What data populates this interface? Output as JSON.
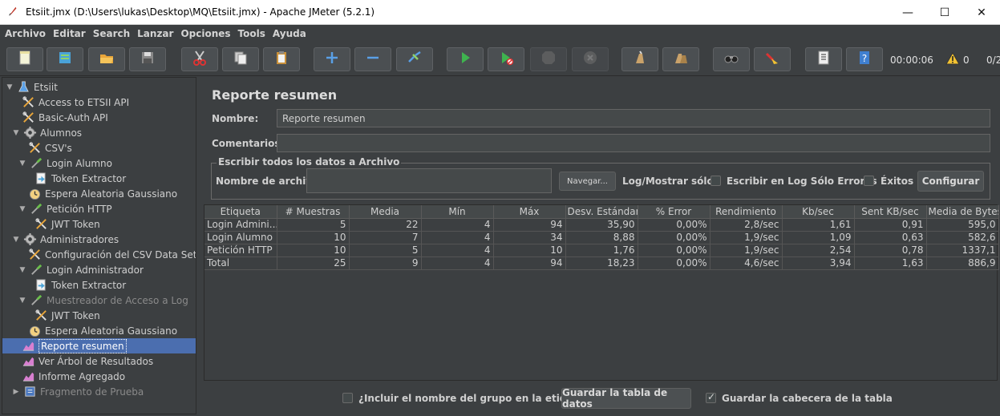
{
  "window": {
    "title": "Etsiit.jmx (D:\\Users\\lukas\\Desktop\\MQ\\Etsiit.jmx) - Apache JMeter (5.2.1)",
    "controls": [
      "—",
      "☐",
      "✕"
    ]
  },
  "menu": [
    "Archivo",
    "Editar",
    "Search",
    "Lanzar",
    "Opciones",
    "Tools",
    "Ayuda"
  ],
  "toolbar": {
    "buttons": [
      "new-icon",
      "templates-icon",
      "open-icon",
      "save-icon",
      "cut-icon",
      "copy-icon",
      "paste-icon",
      "expand-icon",
      "collapse-icon",
      "toggle-icon",
      "start-icon",
      "start-no-pause-icon",
      "stop-icon",
      "shutdown-icon",
      "clear-icon",
      "clear-all-icon",
      "search-icon",
      "reset-search-icon",
      "function-helper-icon",
      "help-icon"
    ],
    "elapsed": "00:00:06",
    "warnings": "0",
    "threads": "0/2"
  },
  "tree": [
    {
      "label": "Etsiit",
      "icon": "test-plan-icon",
      "level": 0,
      "expanded": true
    },
    {
      "label": "Access to ETSII API",
      "icon": "config-icon",
      "level": 1
    },
    {
      "label": "Basic-Auth API",
      "icon": "config-icon",
      "level": 1
    },
    {
      "label": "Alumnos",
      "icon": "thread-group-icon",
      "level": 1,
      "expanded": true
    },
    {
      "label": "CSV's",
      "icon": "config-icon",
      "level": 2
    },
    {
      "label": "Login Alumno",
      "icon": "sampler-icon",
      "level": 2,
      "expanded": true
    },
    {
      "label": "Token Extractor",
      "icon": "extractor-icon",
      "level": 3
    },
    {
      "label": "Espera Aleatoria Gaussiano",
      "icon": "timer-icon",
      "level": 2
    },
    {
      "label": "Petición HTTP",
      "icon": "sampler-icon",
      "level": 2,
      "expanded": true
    },
    {
      "label": "JWT Token",
      "icon": "config-icon",
      "level": 3
    },
    {
      "label": "Administradores",
      "icon": "thread-group-icon",
      "level": 1,
      "expanded": true
    },
    {
      "label": "Configuración del CSV Data Set",
      "icon": "config-icon",
      "level": 2
    },
    {
      "label": "Login Administrador",
      "icon": "sampler-icon",
      "level": 2,
      "expanded": true
    },
    {
      "label": "Token Extractor",
      "icon": "extractor-icon",
      "level": 3
    },
    {
      "label": "Muestreador de Acceso a Log",
      "icon": "sampler-icon",
      "level": 2,
      "expanded": true,
      "disabled": true
    },
    {
      "label": "JWT Token",
      "icon": "config-icon",
      "level": 3
    },
    {
      "label": "Espera Aleatoria Gaussiano",
      "icon": "timer-icon",
      "level": 2
    },
    {
      "label": "Reporte resumen",
      "icon": "listener-icon",
      "level": 1,
      "selected": true
    },
    {
      "label": "Ver Árbol de Resultados",
      "icon": "listener-icon",
      "level": 1
    },
    {
      "label": "Informe Agregado",
      "icon": "listener-icon",
      "level": 1
    },
    {
      "label": "Fragmento de Prueba",
      "icon": "fragment-icon",
      "level": 1,
      "collapsed": true,
      "disabled": true
    }
  ],
  "panel": {
    "title": "Reporte resumen",
    "name_label": "Nombre:",
    "name_value": "Reporte resumen",
    "comments_label": "Comentarios",
    "comments_value": "",
    "file_group_legend": "Escribir todos los datos a Archivo",
    "filename_label": "Nombre de archivo",
    "filename_value": "",
    "browse_button": "Navegar...",
    "log_only_label": "Log/Mostrar sólo:",
    "errors_label": "Escribir en Log Sólo Errores",
    "success_label": "Éxitos",
    "configure_button": "Configurar"
  },
  "table": {
    "headers": [
      "Etiqueta",
      "# Muestras",
      "Media",
      "Mín",
      "Máx",
      "Desv. Estándar",
      "% Error",
      "Rendimiento",
      "Kb/sec",
      "Sent KB/sec",
      "Media de Bytes"
    ],
    "rows": [
      [
        "Login Admini...",
        "5",
        "22",
        "4",
        "94",
        "35,90",
        "0,00%",
        "2,8/sec",
        "1,61",
        "0,91",
        "595,0"
      ],
      [
        "Login Alumno",
        "10",
        "7",
        "4",
        "34",
        "8,88",
        "0,00%",
        "1,9/sec",
        "1,09",
        "0,63",
        "582,6"
      ],
      [
        "Petición HTTP",
        "10",
        "5",
        "4",
        "10",
        "1,76",
        "0,00%",
        "1,9/sec",
        "2,54",
        "0,78",
        "1337,1"
      ],
      [
        "Total",
        "25",
        "9",
        "4",
        "94",
        "18,23",
        "0,00%",
        "4,6/sec",
        "3,94",
        "1,63",
        "886,9"
      ]
    ]
  },
  "footer": {
    "include_group_label": "¿Incluir el nombre del grupo en la etiqueta?",
    "save_table_button": "Guardar la tabla de datos",
    "save_header_label": "Guardar la cabecera de la tabla"
  }
}
